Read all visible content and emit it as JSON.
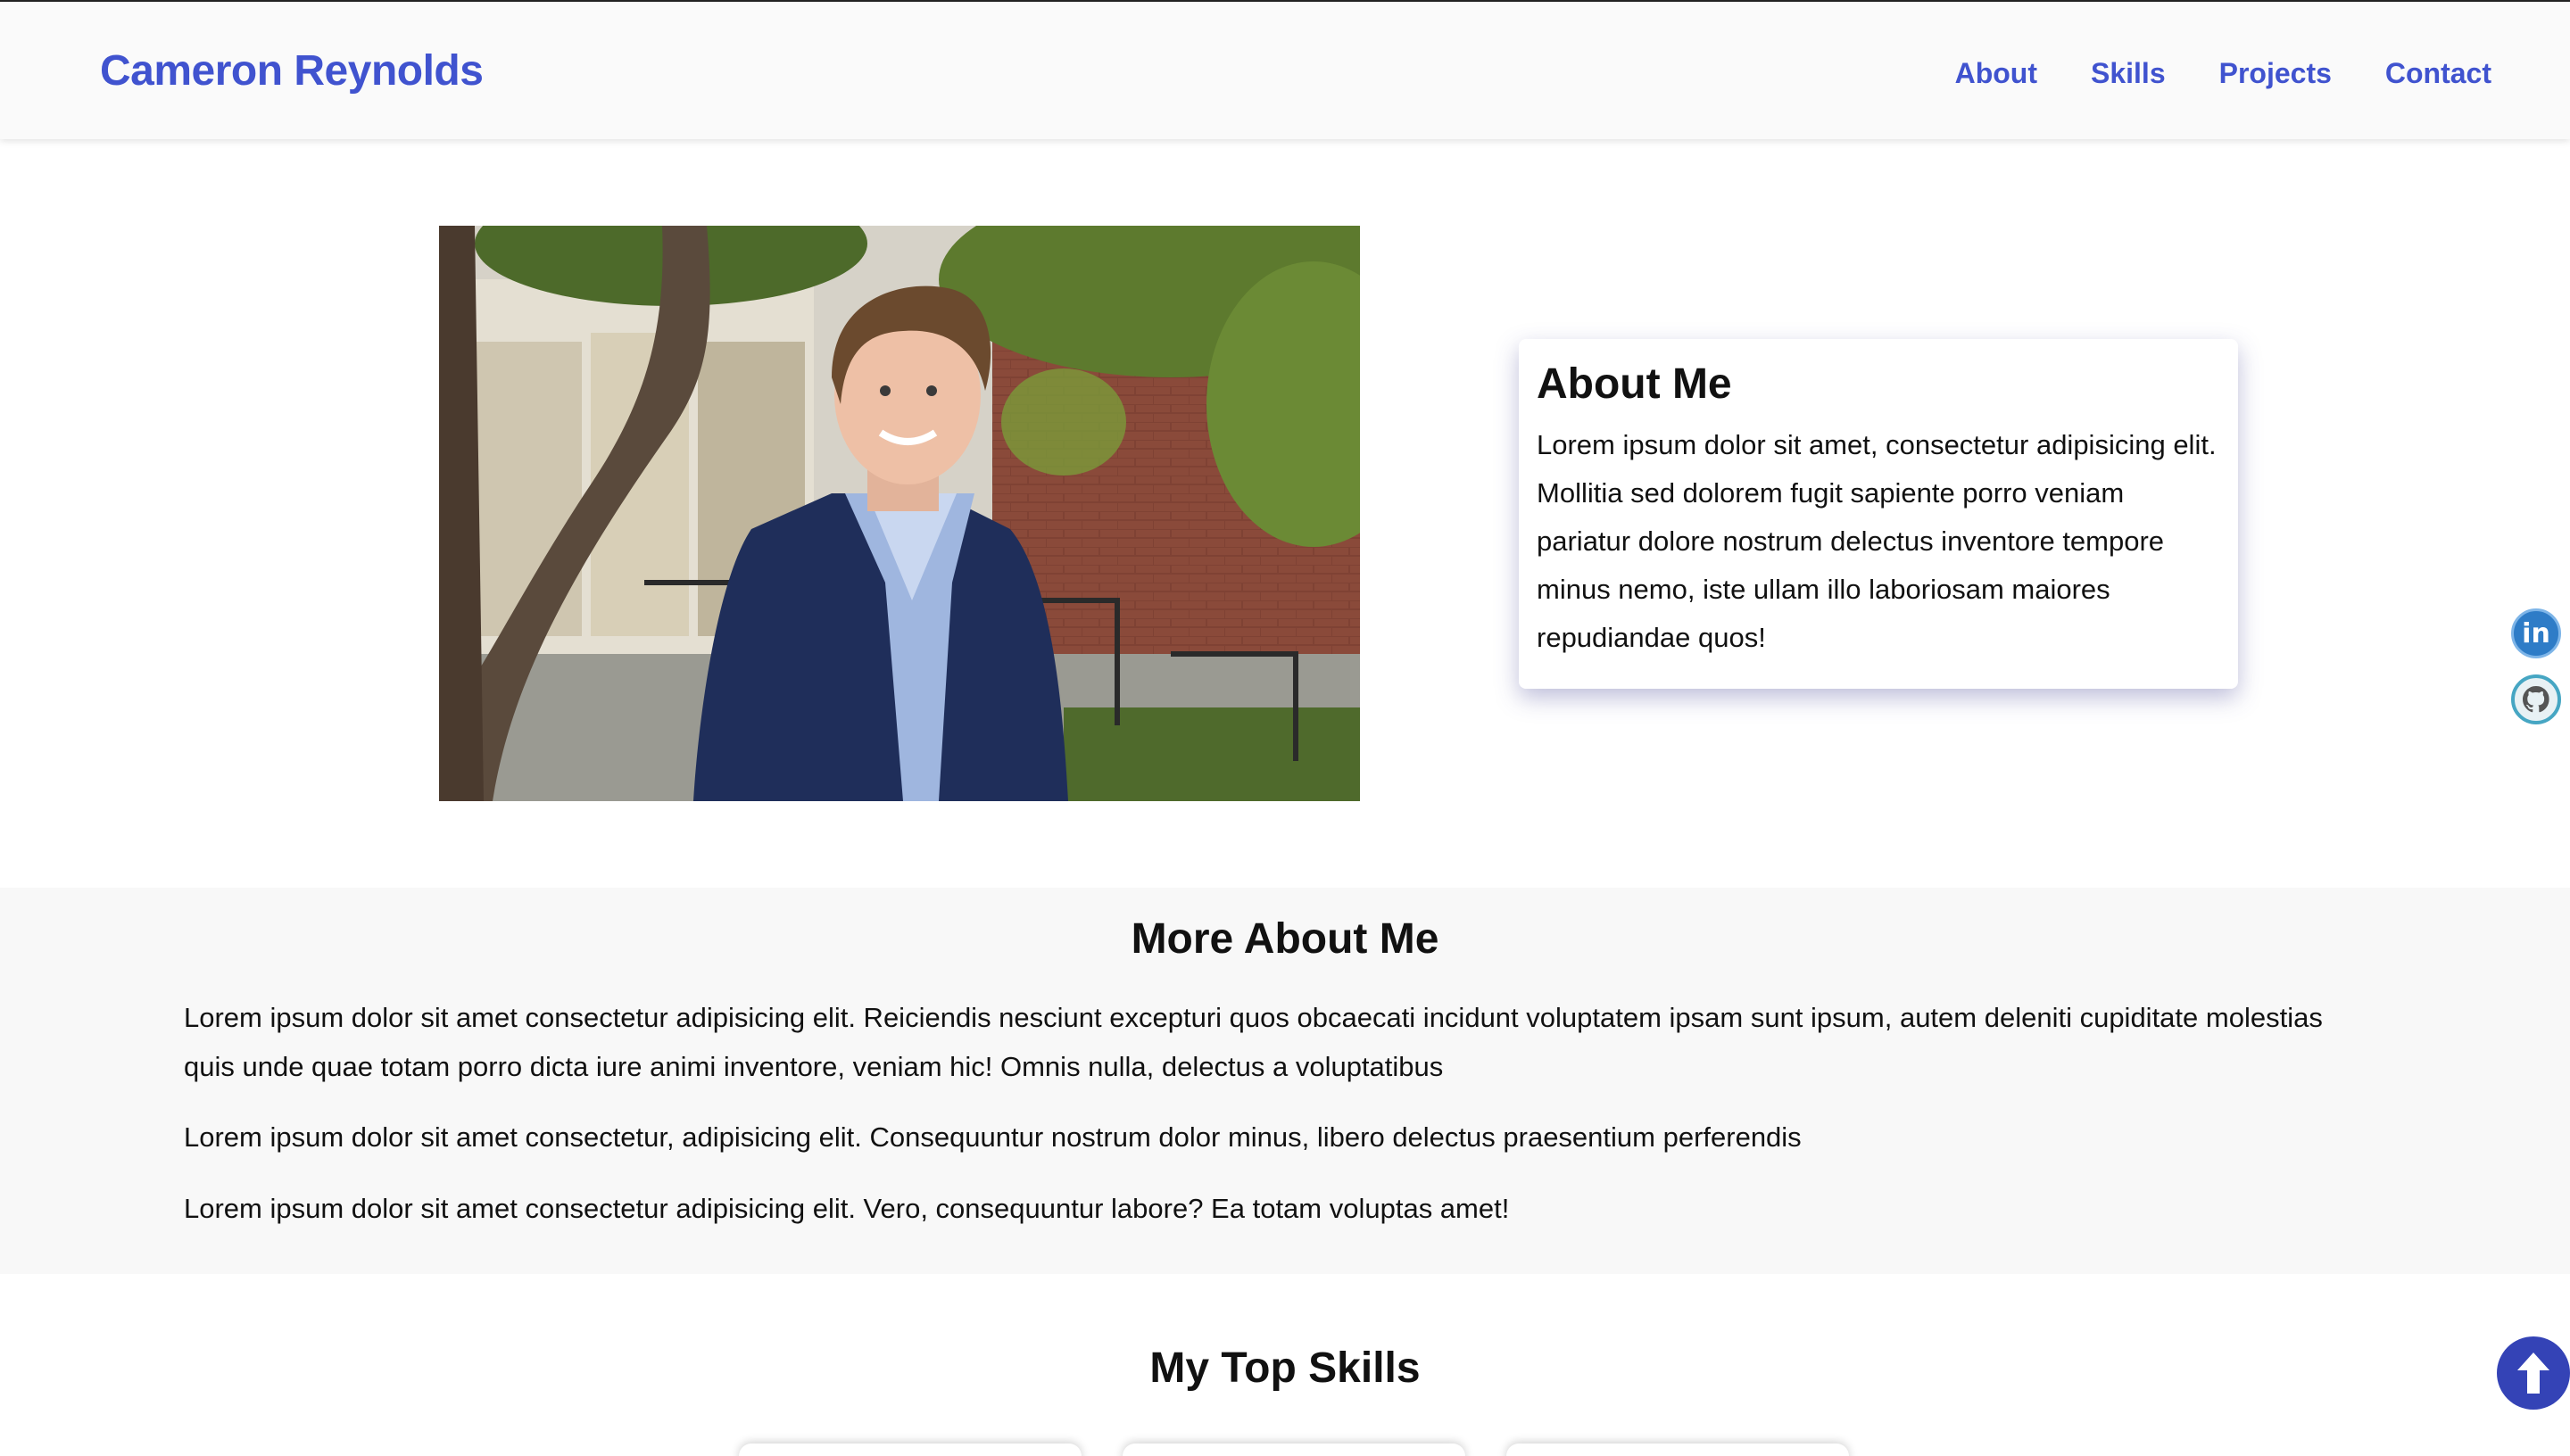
{
  "header": {
    "brand": "Cameron Reynolds",
    "nav": [
      {
        "label": "About"
      },
      {
        "label": "Skills"
      },
      {
        "label": "Projects"
      },
      {
        "label": "Contact"
      }
    ]
  },
  "hero": {
    "photo_icon": "portrait-photo",
    "about_title": "About Me",
    "about_text": "Lorem ipsum dolor sit amet, consectetur adipisicing elit. Mollitia sed dolorem fugit sapiente porro veniam pariatur dolore nostrum delectus inventore tempore minus nemo, iste ullam illo laboriosam maiores repudiandae quos!"
  },
  "social": {
    "linkedin_icon": "linkedin-icon",
    "linkedin_text": "in",
    "github_icon": "github-icon"
  },
  "more": {
    "title": "More About Me",
    "paragraphs": [
      "Lorem ipsum dolor sit amet consectetur adipisicing elit. Reiciendis nesciunt excepturi quos obcaecati incidunt voluptatem ipsam sunt ipsum, autem deleniti cupiditate molestias quis unde quae totam porro dicta iure animi inventore, veniam hic! Omnis nulla, delectus a voluptatibus",
      "Lorem ipsum dolor sit amet consectetur, adipisicing elit. Consequuntur nostrum dolor minus, libero delectus praesentium perferendis",
      "Lorem ipsum dolor sit amet consectetur adipisicing elit. Vero, consequuntur labore? Ea totam voluptas amet!"
    ]
  },
  "skills": {
    "title": "My Top Skills"
  },
  "scroll_top": {
    "icon": "arrow-up-icon"
  },
  "colors": {
    "accent": "#4053cf",
    "scroll_button": "#3443b6",
    "linkedin": "#2e7cc7",
    "github_ring": "#46a6c3"
  }
}
